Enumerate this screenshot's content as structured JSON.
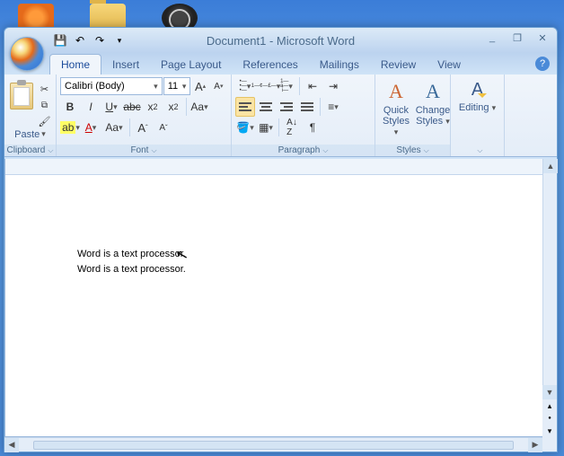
{
  "desktop": {
    "icons": [
      "fire",
      "folder",
      "dark"
    ]
  },
  "window": {
    "title": "Document1 - Microsoft Word",
    "qat": {
      "save": "Save",
      "undo": "Undo",
      "redo": "Redo"
    },
    "controls": {
      "min": "_",
      "max": "❐",
      "close": "✕"
    }
  },
  "tabs": {
    "items": [
      "Home",
      "Insert",
      "Page Layout",
      "References",
      "Mailings",
      "Review",
      "View"
    ],
    "active": 0,
    "help": "?"
  },
  "ribbon": {
    "clipboard": {
      "label": "Clipboard",
      "paste": "Paste"
    },
    "font": {
      "label": "Font",
      "name": "Calibri (Body)",
      "size": "11",
      "bold": "B",
      "italic": "I",
      "underline": "U",
      "strike": "abc",
      "sub": "x",
      "sup": "x",
      "clear": "Aa",
      "highlight": "ab",
      "color": "A",
      "case": "Aa",
      "grow": "A",
      "shrink": "A"
    },
    "paragraph": {
      "label": "Paragraph"
    },
    "styles": {
      "label": "Styles",
      "quick": "Quick Styles",
      "change": "Change Styles"
    },
    "editing": {
      "label": "Editing"
    }
  },
  "document": {
    "lines": [
      "Word is a text processor.",
      "Word is a text processor."
    ]
  }
}
